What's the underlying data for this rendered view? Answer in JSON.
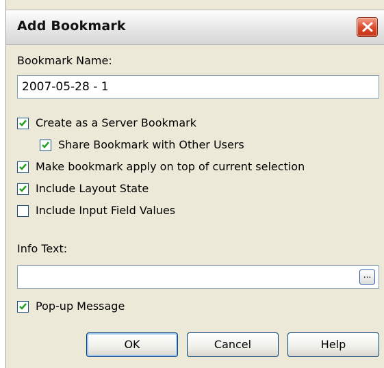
{
  "window": {
    "title": "Add Bookmark",
    "close_icon": "close-icon"
  },
  "bookmark_name": {
    "label": "Bookmark Name:",
    "value": "2007-05-28 - 1"
  },
  "options": [
    {
      "label": "Create as a Server Bookmark",
      "checked": true
    },
    {
      "label": "Share Bookmark with Other Users",
      "checked": true
    },
    {
      "label": "Make bookmark apply on top of current selection",
      "checked": true
    },
    {
      "label": "Include Layout State",
      "checked": true
    },
    {
      "label": "Include Input Field Values",
      "checked": false
    }
  ],
  "info_text": {
    "label": "Info Text:",
    "value": "",
    "browse_label": "..."
  },
  "popup": {
    "label": "Pop-up Message",
    "checked": true
  },
  "buttons": {
    "ok": "OK",
    "cancel": "Cancel",
    "help": "Help"
  },
  "colors": {
    "check": "#21a121",
    "close_button": "#d8482a",
    "button_border": "#003c74"
  }
}
